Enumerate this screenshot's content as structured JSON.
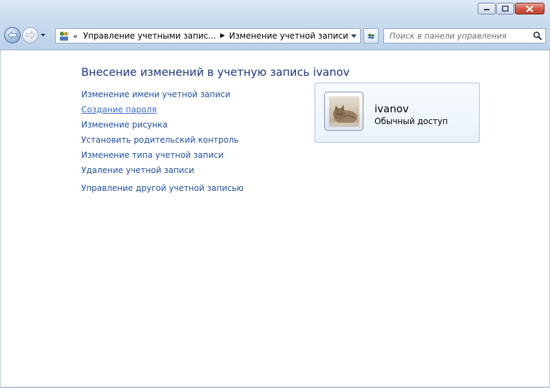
{
  "addressbar": {
    "segment1": "Управление учетными запис...",
    "segment2": "Изменение учетной записи"
  },
  "search": {
    "placeholder": "Поиск в панели управления"
  },
  "main": {
    "heading": "Внесение изменений в учетную запись ivanov",
    "links": [
      "Изменение имени учетной записи",
      "Создание пароля",
      "Изменение рисунка",
      "Установить родительский контроль",
      "Изменение типа учетной записи",
      "Удаление учетной записи"
    ],
    "other_link": "Управление другой учетной записью"
  },
  "account": {
    "name": "ivanov",
    "type": "Обычный доступ",
    "picture": "kitten-photo"
  },
  "colors": {
    "link": "#1f4fa8",
    "heading": "#1e3287",
    "close_button": "#c1412c"
  },
  "icons": [
    "back-arrow-icon",
    "forward-arrow-icon",
    "control-panel-icon",
    "refresh-icon",
    "search-icon",
    "minimize-icon",
    "maximize-icon",
    "close-icon"
  ]
}
